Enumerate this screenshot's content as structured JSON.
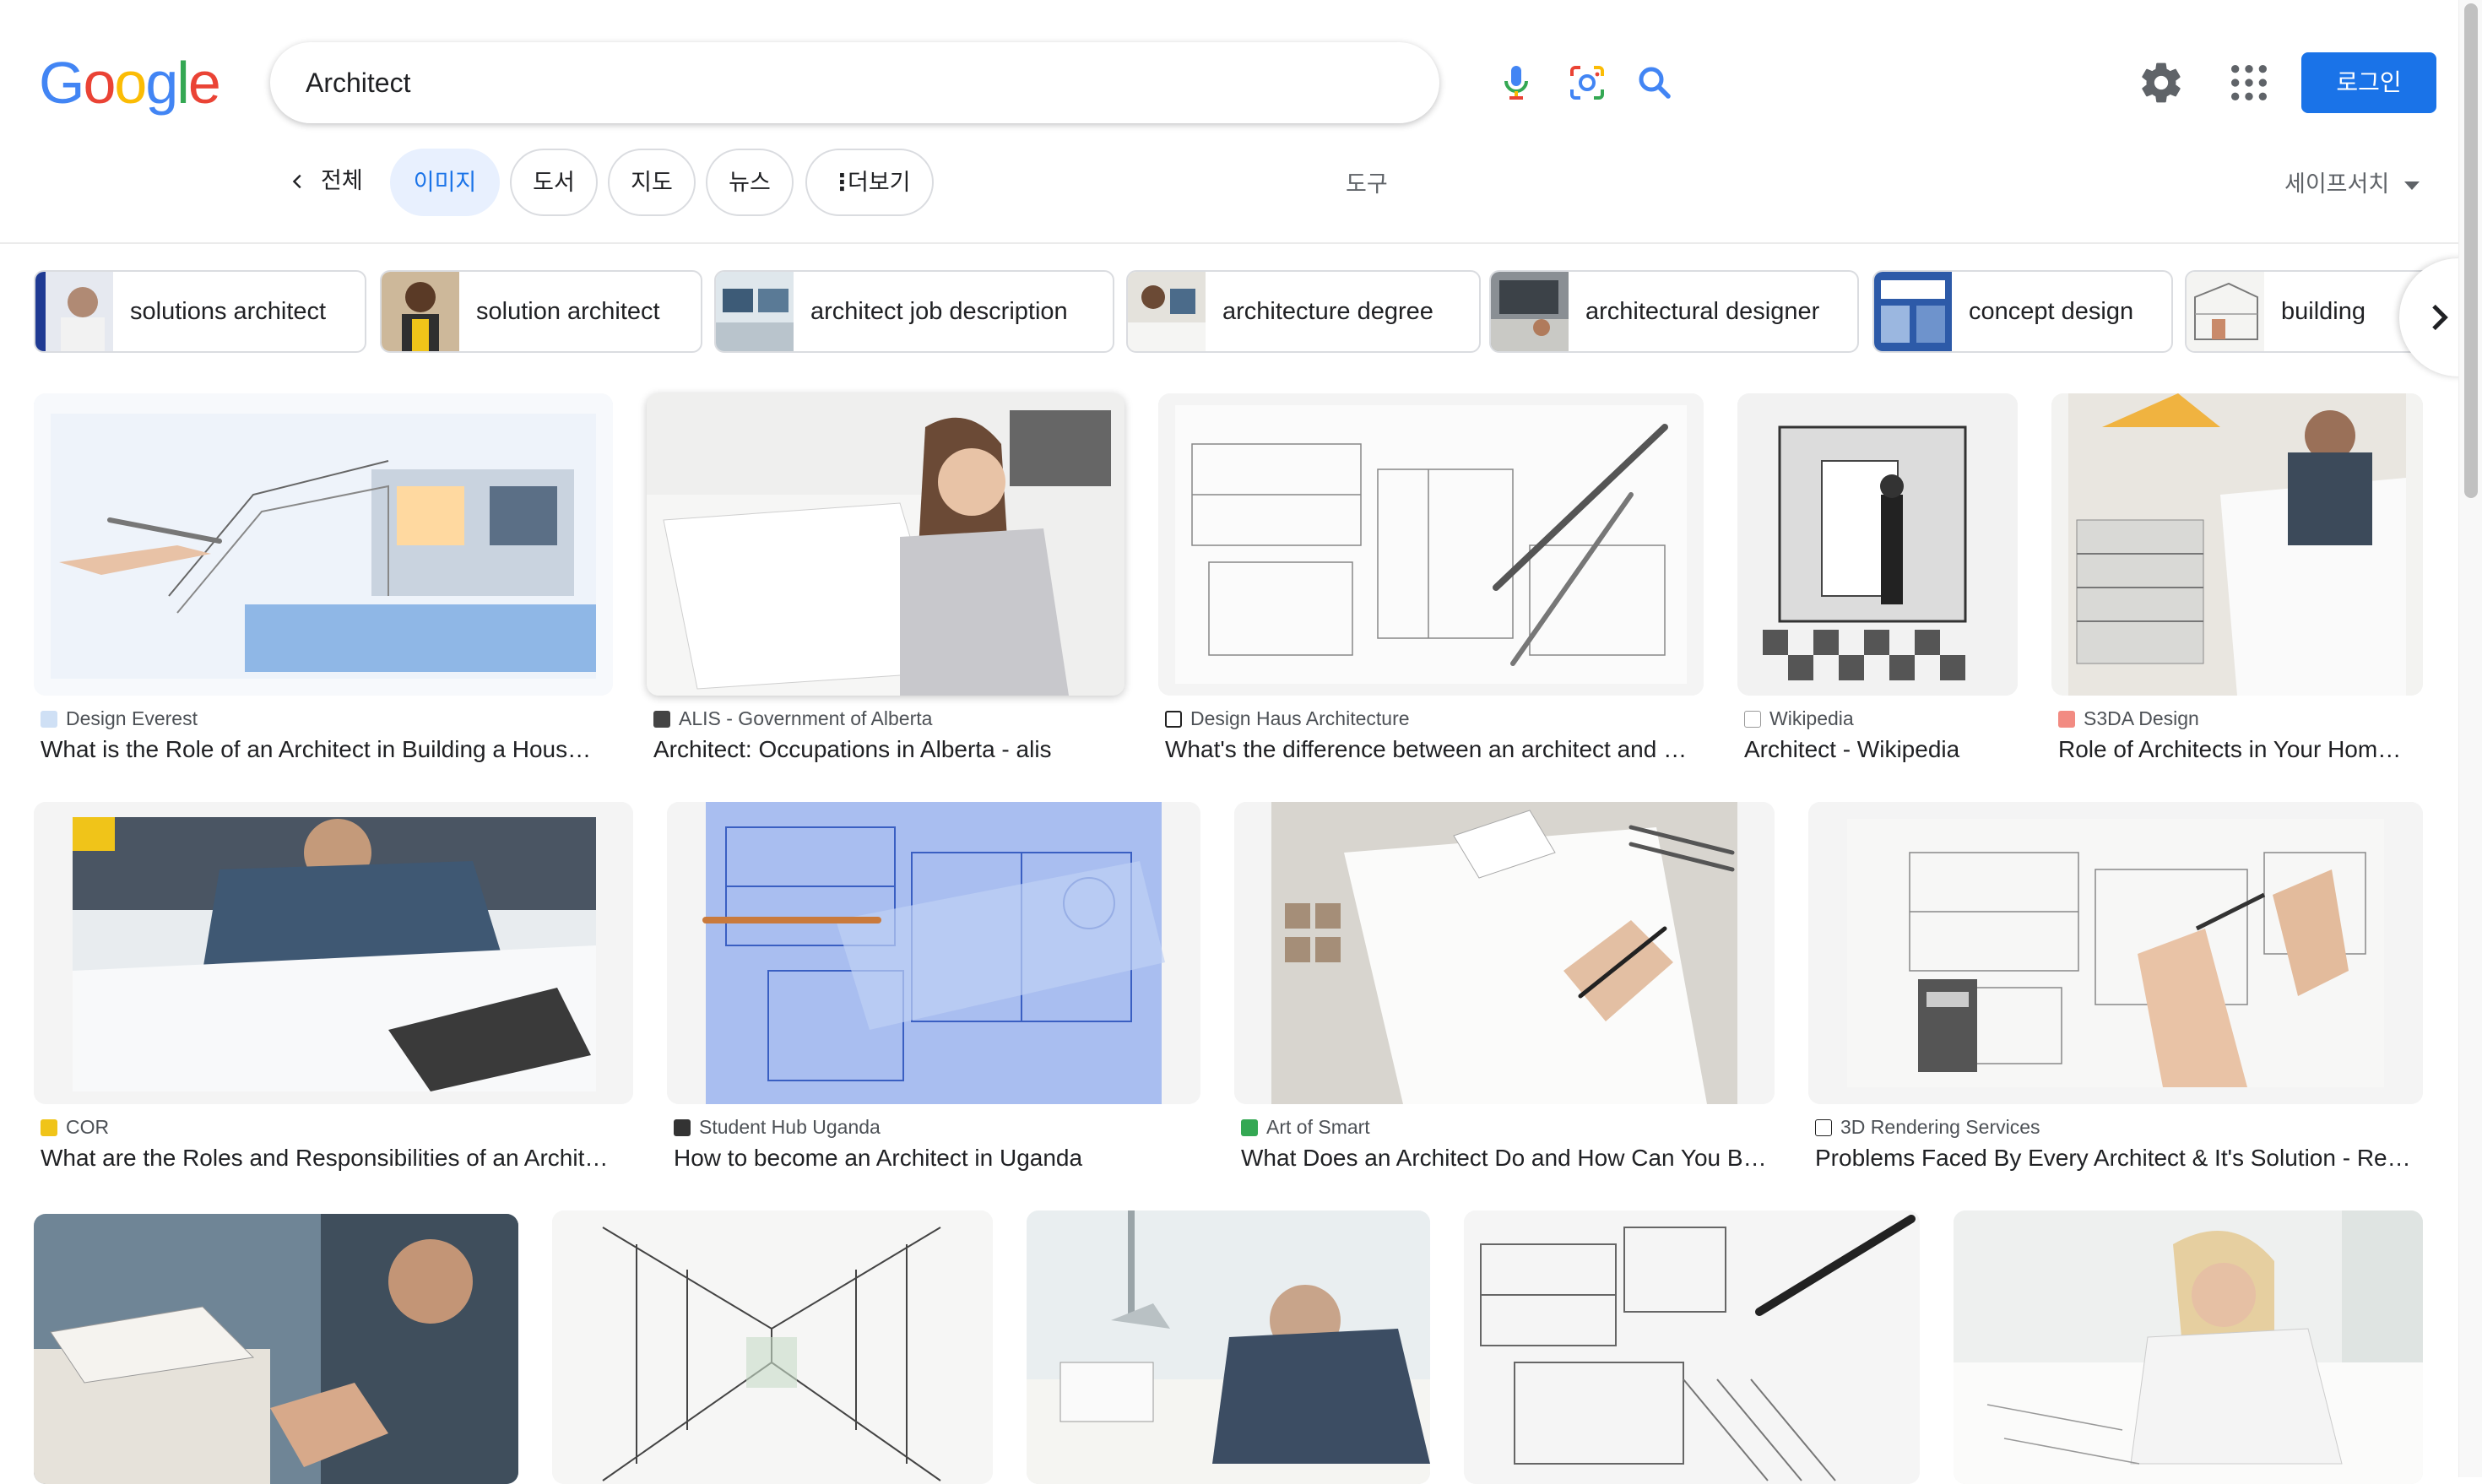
{
  "search": {
    "query": "Architect"
  },
  "header": {
    "login_label": "로그인"
  },
  "tabs": {
    "back_label": "전체",
    "items": [
      "이미지",
      "도서",
      "지도",
      "뉴스",
      "더보기"
    ],
    "tools": "도구",
    "safesearch": "세이프서치"
  },
  "chips": [
    "solutions architect",
    "solution architect",
    "architect job description",
    "architecture degree",
    "architectural designer",
    "concept design",
    "building"
  ],
  "results": [
    {
      "source": "Design Everest",
      "title": "What is the Role of an Architect in Building a Hous…"
    },
    {
      "source": "ALIS - Government of Alberta",
      "title": "Architect: Occupations in Alberta - alis"
    },
    {
      "source": "Design Haus Architecture",
      "title": "What's the difference between an architect and …"
    },
    {
      "source": "Wikipedia",
      "title": "Architect - Wikipedia"
    },
    {
      "source": "S3DA Design",
      "title": "Role of Architects in Your Hom…"
    },
    {
      "source": "COR",
      "title": "What are the Roles and Responsibilities of an Archit…"
    },
    {
      "source": "Student Hub Uganda",
      "title": "How to become an Architect in Uganda"
    },
    {
      "source": "Art of Smart",
      "title": "What Does an Architect Do and How Can You B…"
    },
    {
      "source": "3D Rendering Services",
      "title": "Problems Faced By Every Architect & It's Solution - Re…"
    }
  ],
  "colors": {
    "accent": "#1a73e8",
    "active_tab_bg": "#e8f0fe",
    "logo_blue": "#4285f4",
    "logo_red": "#ea4335",
    "logo_yellow": "#fbbc05",
    "logo_green": "#34a853"
  }
}
